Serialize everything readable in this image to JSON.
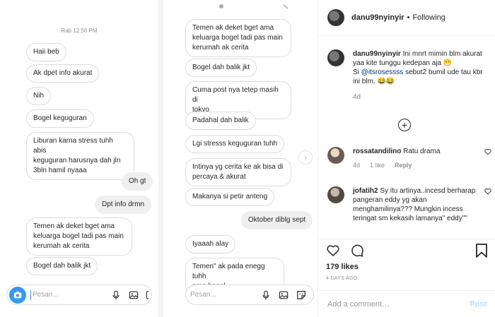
{
  "photo": {
    "left_screenshot": {
      "timestamp": "Rab 12:56 PM",
      "messages": [
        {
          "text": "Haii beb",
          "dir": "in"
        },
        {
          "text": "Ak dpet info akurat",
          "dir": "in"
        },
        {
          "text": "Nih",
          "dir": "in"
        },
        {
          "text": "Bogel keguguran",
          "dir": "in"
        },
        {
          "text": "Liburan karna stress tuhh abis\nkeguguran harusnya dah jln\n3bln hamil nyaaa",
          "dir": "in"
        },
        {
          "text": "Oh gt",
          "dir": "out"
        },
        {
          "text": "Dpt info drmn",
          "dir": "out"
        },
        {
          "text": "Temen ak deket bget ama\nkeluarga bogel tadi pas main\nkerumah ak cerita",
          "dir": "in"
        },
        {
          "text": "Bogel dah balik jkt",
          "dir": "in"
        }
      ],
      "composer_placeholder": "Pesan..."
    },
    "right_screenshot": {
      "messages": [
        {
          "text": "Temen ak deket bget ama\nkeluarga bogel tadi pas main\nkerumah ak cerita",
          "dir": "in"
        },
        {
          "text": "Bogel dah balik jkt",
          "dir": "in"
        },
        {
          "text": "Cuma post nya tetep masih di\ntokyo",
          "dir": "in"
        },
        {
          "text": "Padahal dah balik",
          "dir": "in"
        },
        {
          "text": "Lgi stresss keguguran tuhh",
          "dir": "in"
        },
        {
          "text": "Intinya yg cerita ke ak bisa di\npercaya & akurat",
          "dir": "in"
        },
        {
          "text": "Makanya si petir anteng",
          "dir": "in"
        },
        {
          "text": "Oktober diblg sept",
          "dir": "out"
        },
        {
          "text": "Iyaaah alay",
          "dir": "in"
        },
        {
          "text": "Temen\" ak pada enegg tuhh\nama bogel",
          "dir": "in"
        }
      ],
      "composer_placeholder": "Pesan..."
    }
  },
  "panel": {
    "header": {
      "username": "danu99nyinyir",
      "separator": "•",
      "follow_status": "Following"
    },
    "caption": {
      "username": "danu99nyinyir",
      "text": "Ini mnrt mimin blm akurat yaa kite tunggu kedepan aja 😁",
      "mention": "@itsrosessss",
      "text2": "sebut2 bumil ude tau kbr ini blm. 😂😂",
      "prefix2": "Si",
      "time": "4d"
    },
    "comments": [
      {
        "username": "rossatandilino",
        "text": "Ratu drama",
        "time": "4d",
        "likes": "1 like",
        "reply": "Reply"
      },
      {
        "username": "jofatih2",
        "text": "Sy itu artinya..incesd berharap pangeran eddy yg akan menghamilinya??? Mungkin incess teringat sm kekasih lamanya\" eddy\"\""
      }
    ],
    "likes": "179 likes",
    "date": "4 DAYS AGO",
    "add_comment_placeholder": "Add a comment…",
    "post_label": "Post"
  }
}
